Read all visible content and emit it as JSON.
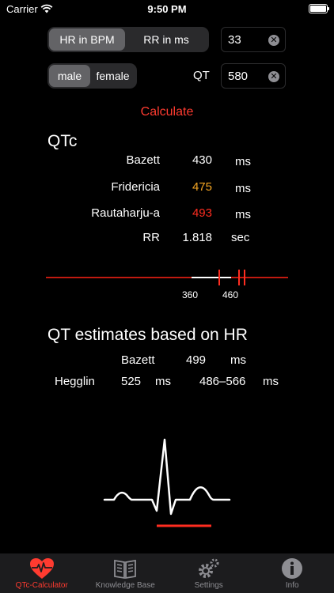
{
  "status_bar": {
    "carrier": "Carrier",
    "time": "9:50 PM"
  },
  "input_mode": {
    "options": [
      "HR in BPM",
      "RR in ms"
    ],
    "selected": "HR in BPM"
  },
  "hr_field": {
    "value": "33"
  },
  "sex": {
    "options": [
      "male",
      "female"
    ],
    "selected": "male"
  },
  "qt_field": {
    "label": "QT",
    "value": "580"
  },
  "calculate_label": "Calculate",
  "qtc": {
    "title": "QTc",
    "rows": [
      {
        "label": "Bazett",
        "value": "430",
        "unit": "ms",
        "color": "#ffffff"
      },
      {
        "label": "Fridericia",
        "value": "475",
        "unit": "ms",
        "color": "#f5a623"
      },
      {
        "label": "Rautaharju-a",
        "value": "493",
        "unit": "ms",
        "color": "#ff2d20"
      },
      {
        "label": "RR",
        "value": "1.818",
        "unit": "sec",
        "color": "#ffffff"
      }
    ]
  },
  "scale": {
    "tick_labels": [
      "360",
      "460"
    ]
  },
  "estimates": {
    "title": "QT estimates based on HR",
    "bazett": {
      "label": "Bazett",
      "value": "499",
      "unit": "ms"
    },
    "hegglin": {
      "label": "Hegglin",
      "value": "525",
      "unit": "ms",
      "range": "486–566",
      "range_unit": "ms"
    }
  },
  "tabs": [
    {
      "label": "QTc-Calculator",
      "icon": "heart-pulse-icon",
      "active": true
    },
    {
      "label": "Knowledge Base",
      "icon": "book-icon",
      "active": false
    },
    {
      "label": "Settings",
      "icon": "gear-icon",
      "active": false
    },
    {
      "label": "Info",
      "icon": "info-icon",
      "active": false
    }
  ],
  "colors": {
    "accent": "#ff3b30",
    "orange": "#f5a623",
    "red": "#ff2d20"
  }
}
